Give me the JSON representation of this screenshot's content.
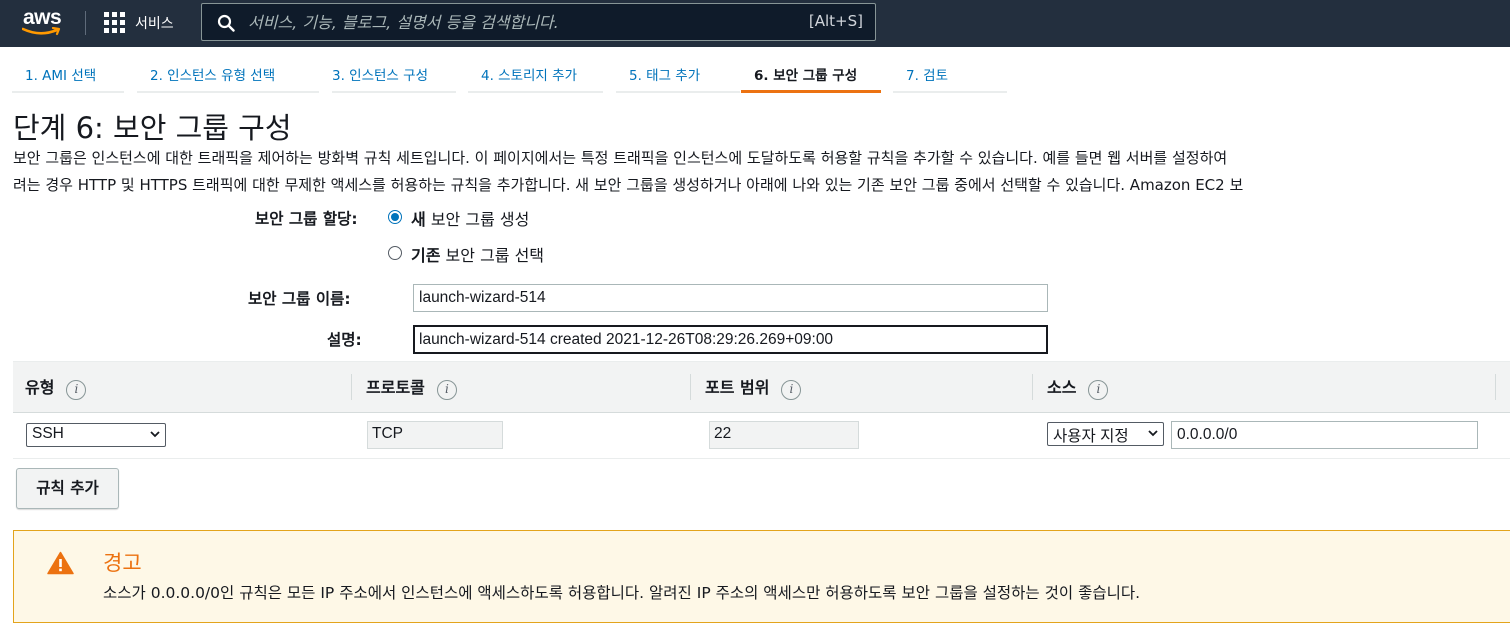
{
  "nav": {
    "logo_text": "aws",
    "services_label": "서비스",
    "search_placeholder": "서비스, 기능, 블로그, 설명서 등을 검색합니다.",
    "search_shortcut": "[Alt+S]"
  },
  "steps": [
    {
      "label": "1. AMI 선택",
      "active": false
    },
    {
      "label": "2. 인스턴스 유형 선택",
      "active": false
    },
    {
      "label": "3. 인스턴스 구성",
      "active": false
    },
    {
      "label": "4. 스토리지 추가",
      "active": false
    },
    {
      "label": "5. 태그 추가",
      "active": false
    },
    {
      "label": "6. 보안 그룹 구성",
      "active": true
    },
    {
      "label": "7. 검토",
      "active": false
    }
  ],
  "page": {
    "title": "단계 6: 보안 그룹 구성",
    "description_line1": "보안 그룹은 인스턴스에 대한 트래픽을 제어하는 방화벽 규칙 세트입니다. 이 페이지에서는 특정 트래픽을 인스턴스에 도달하도록 허용할 규칙을 추가할 수 있습니다. 예를 들면 웹 서버를 설정하여",
    "description_line2": "려는 경우 HTTP 및 HTTPS 트래픽에 대한 무제한 액세스를 허용하는 규칙을 추가합니다. 새 보안 그룹을 생성하거나 아래에 나와 있는 기존 보안 그룹 중에서 선택할 수 있습니다. Amazon EC2 보"
  },
  "form": {
    "assign_label": "보안 그룹 할당:",
    "option_new_bold": "새",
    "option_new_rest": " 보안 그룹 생성",
    "option_existing_bold": "기존",
    "option_existing_rest": " 보안 그룹 선택",
    "selected_option": "new",
    "name_label": "보안 그룹 이름:",
    "name_value": "launch-wizard-514",
    "description_label": "설명:",
    "description_value": "launch-wizard-514 created 2021-12-26T08:29:26.269+09:00"
  },
  "rules_table": {
    "columns": [
      "유형",
      "프로토콜",
      "포트 범위",
      "소스"
    ],
    "rows": [
      {
        "type": "SSH",
        "protocol": "TCP",
        "port_range": "22",
        "source_type": "사용자 지정",
        "source_value": "0.0.0.0/0"
      }
    ],
    "add_rule_button": "규칙 추가"
  },
  "warning": {
    "title": "경고",
    "message": "소스가 0.0.0.0/0인 규칙은 모든 IP 주소에서 인스턴스에 액세스하도록 허용합니다. 알려진 IP 주소의 액세스만 허용하도록 보안 그룹을 설정하는 것이 좋습니다."
  },
  "colors": {
    "nav_bg": "#232f3e",
    "link_blue": "#0073bb",
    "active_tab_underline": "#ec7211",
    "warning_bg": "#fef8e7",
    "warning_border": "#e3a41c",
    "warning_title": "#ec7211"
  },
  "icons": [
    "aws-logo",
    "grid-icon",
    "search-icon",
    "info-icon",
    "chevron-down-icon",
    "warning-icon"
  ]
}
